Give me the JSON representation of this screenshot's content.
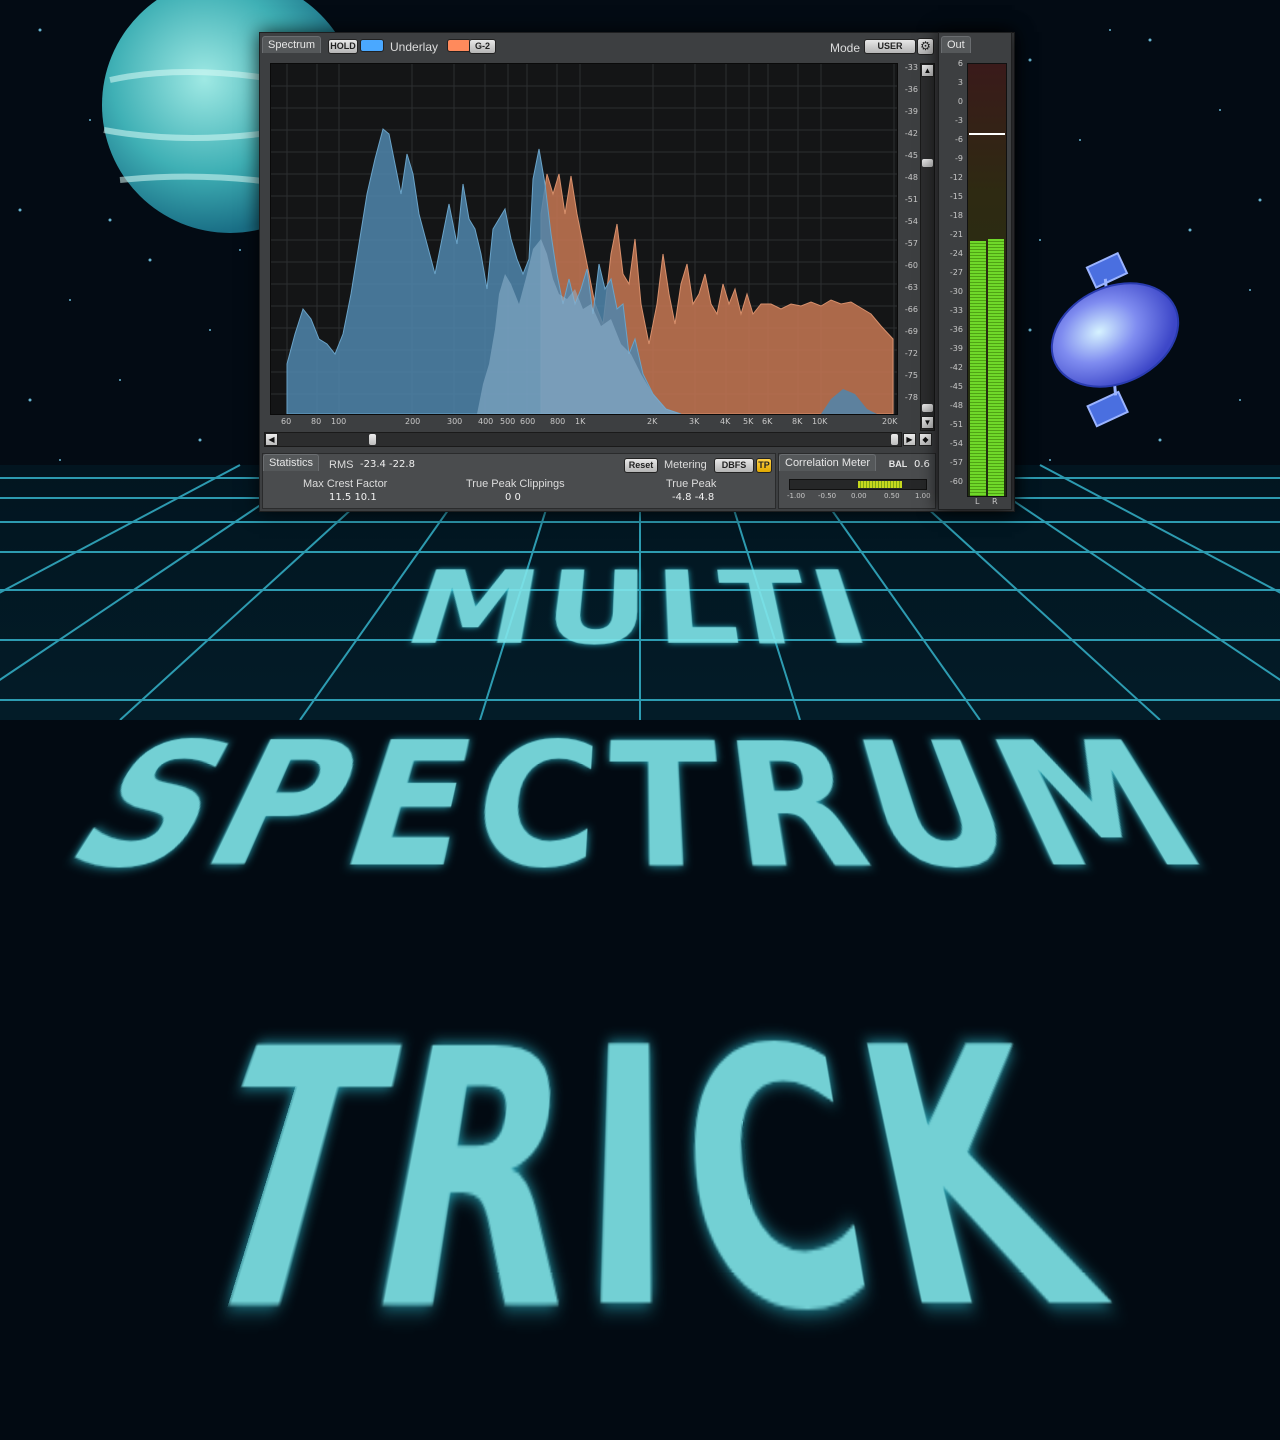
{
  "header": {
    "spectrum_tab": "Spectrum",
    "hold_label": "HOLD",
    "underlay_label": "Underlay",
    "underlay_preset": "G-2",
    "mode_label": "Mode",
    "mode_value": "USER",
    "out_tab": "Out"
  },
  "colors": {
    "live_spectrum": "#4f86ad",
    "underlay_spectrum": "#c27552",
    "hold_swatch": "#4aa8ff",
    "underlay_swatch": "#ff8a5c",
    "meter_green": "#5cc21a"
  },
  "freq_axis": [
    "60",
    "80",
    "100",
    "200",
    "300",
    "400",
    "500",
    "600",
    "800",
    "1K",
    "2K",
    "3K",
    "4K",
    "5K",
    "6K",
    "8K",
    "10K",
    "20K"
  ],
  "db_axis": [
    "-33",
    "-36",
    "-39",
    "-42",
    "-45",
    "-48",
    "-51",
    "-54",
    "-57",
    "-60",
    "-63",
    "-66",
    "-69",
    "-72",
    "-75",
    "-78"
  ],
  "statistics": {
    "tab": "Statistics",
    "rms_label": "RMS",
    "rms_values": "-23.4  -22.8",
    "reset_label": "Reset",
    "metering_label": "Metering",
    "metering_value": "DBFS",
    "tp_label": "TP",
    "max_crest_label": "Max Crest Factor",
    "max_crest_values": "11.5  10.1",
    "true_peak_clippings_label": "True Peak Clippings",
    "true_peak_clippings_values": "0     0",
    "true_peak_label": "True Peak",
    "true_peak_values": "-4.8  -4.8"
  },
  "correlation": {
    "tab": "Correlation Meter",
    "bal_label": "BAL",
    "bal_value": "0.6",
    "scale": [
      "-1.00",
      "-0.50",
      "0.00",
      "0.50",
      "1.00"
    ]
  },
  "output_meter": {
    "scale": [
      "6",
      "3",
      "0",
      "-3",
      "-6",
      "-9",
      "-12",
      "-15",
      "-18",
      "-21",
      "-24",
      "-27",
      "-30",
      "-33",
      "-36",
      "-39",
      "-42",
      "-45",
      "-48",
      "-51",
      "-54",
      "-57",
      "-60"
    ],
    "left_label": "L",
    "right_label": "R",
    "level_db": -21,
    "peak_hold_db": -4.5
  },
  "title_art": "MULTI SPECTRUM TRICK"
}
